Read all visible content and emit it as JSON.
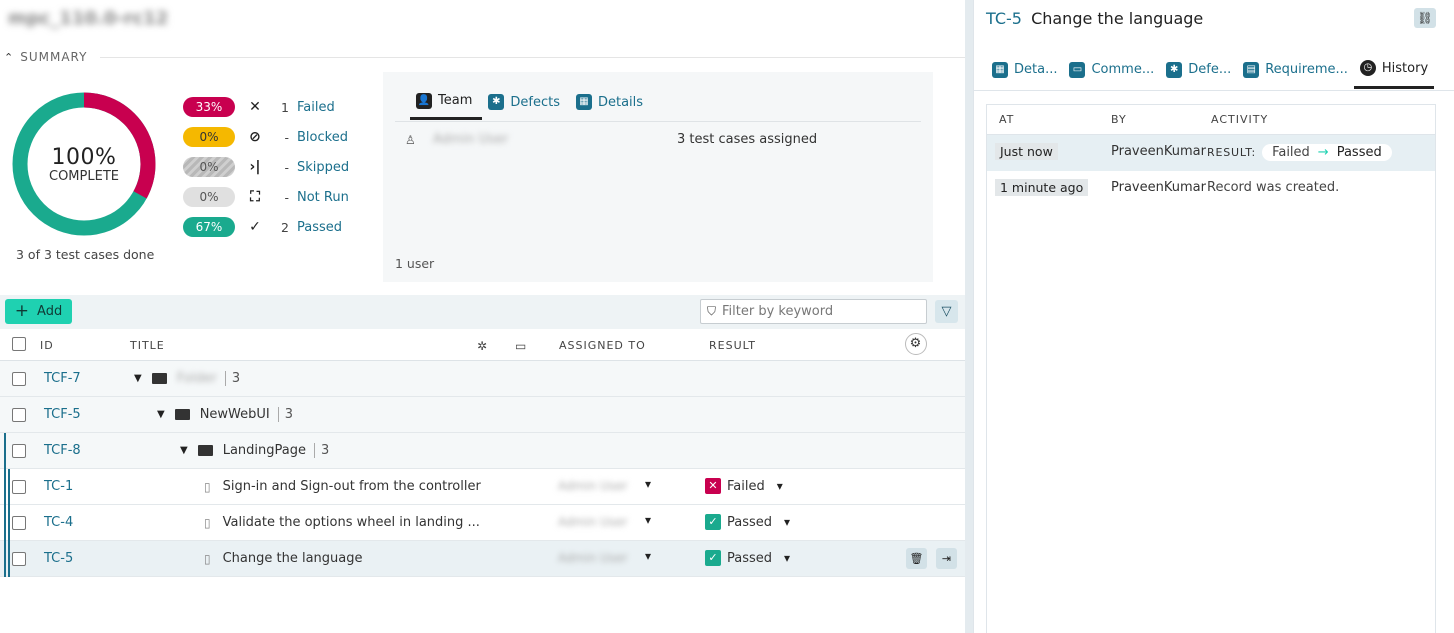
{
  "run": {
    "title": "mpc_110.0-rc12"
  },
  "summary": {
    "header": "SUMMARY",
    "percent": "100%",
    "complete_label": "COMPLETE",
    "done_text": "3 of 3 test cases done",
    "donut": {
      "failed_fraction": 0.33,
      "passed_fraction": 0.67,
      "failed_color": "#c8004f",
      "passed_color": "#1aaa8e"
    },
    "stats": [
      {
        "pct": "33%",
        "icon": "x-icon",
        "count": "1",
        "label": "Failed"
      },
      {
        "pct": "0%",
        "icon": "blocked-icon",
        "count": "-",
        "label": "Blocked"
      },
      {
        "pct": "0%",
        "icon": "skip-icon",
        "count": "-",
        "label": "Skipped"
      },
      {
        "pct": "0%",
        "icon": "not-run-icon",
        "count": "-",
        "label": "Not Run"
      },
      {
        "pct": "67%",
        "icon": "check-icon",
        "count": "2",
        "label": "Passed"
      }
    ]
  },
  "team": {
    "tabs": [
      {
        "label": "Team",
        "icon": "user-icon"
      },
      {
        "label": "Defects",
        "icon": "bug-icon"
      },
      {
        "label": "Details",
        "icon": "details-icon"
      }
    ],
    "member": {
      "name": "Admin User",
      "assigned": "3 test cases assigned"
    },
    "footer": "1 user"
  },
  "toolbar": {
    "add_label": "Add",
    "filter_placeholder": "Filter by keyword"
  },
  "grid": {
    "headers": {
      "id": "ID",
      "title": "TITLE",
      "assigned": "ASSIGNED TO",
      "result": "RESULT"
    },
    "rows": [
      {
        "id": "TCF-7",
        "title": "Folder",
        "count": "3"
      },
      {
        "id": "TCF-5",
        "title": "NewWebUI",
        "count": "3"
      },
      {
        "id": "TCF-8",
        "title": "LandingPage",
        "count": "3"
      },
      {
        "id": "TC-1",
        "title": "Sign-in and Sign-out from the controller",
        "assignee": "Admin User",
        "result": "Failed"
      },
      {
        "id": "TC-4",
        "title": "Validate the options wheel in landing ...",
        "assignee": "Admin User",
        "result": "Passed"
      },
      {
        "id": "TC-5",
        "title": "Change the language",
        "assignee": "Admin User",
        "result": "Passed"
      }
    ]
  },
  "panel": {
    "key": "TC-5",
    "title": "Change the language",
    "tabs": [
      {
        "label": "Deta...",
        "icon": "details-icon"
      },
      {
        "label": "Comme...",
        "icon": "comment-icon"
      },
      {
        "label": "Defe...",
        "icon": "bug-icon"
      },
      {
        "label": "Requireme...",
        "icon": "document-icon"
      },
      {
        "label": "History",
        "icon": "history-icon"
      }
    ],
    "history": {
      "headers": {
        "at": "AT",
        "by": "BY",
        "activity": "ACTIVITY"
      },
      "rows": [
        {
          "at": "Just now",
          "by": "PraveenKumar",
          "result_label": "RESULT:",
          "from": "Failed",
          "to": "Passed"
        },
        {
          "at": "1 minute ago",
          "by": "PraveenKumar",
          "activity": "Record was created."
        }
      ]
    }
  }
}
